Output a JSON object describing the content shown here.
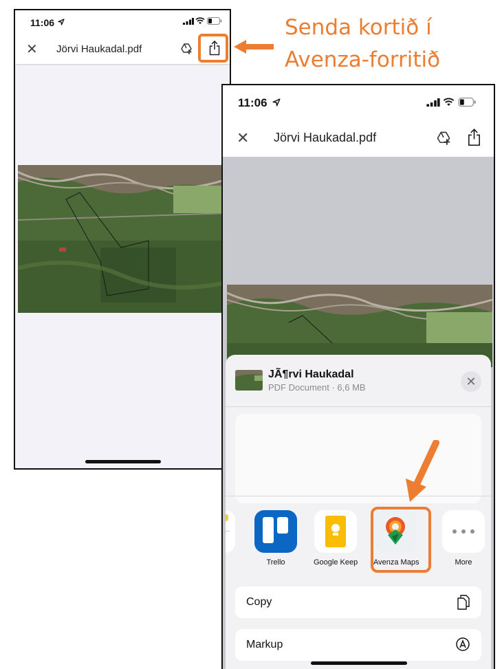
{
  "annotation": {
    "line1": "Senda kortið í",
    "line2": "Avenza-forritið",
    "color": "#ed7d31"
  },
  "phone1": {
    "time": "11:06",
    "doc_title": "Jörvi Haukadal.pdf"
  },
  "phone2": {
    "time": "11:06",
    "doc_title": "Jörvi Haukadal.pdf",
    "share_sheet": {
      "file_name": "JÃ¶rvi Haukadal",
      "file_meta": "PDF Document · 6,6 MB",
      "apps": [
        {
          "label": "Trello",
          "icon": "trello-icon"
        },
        {
          "label": "Google Keep",
          "icon": "google-keep-icon"
        },
        {
          "label": "Avenza Maps",
          "icon": "avenza-maps-icon"
        },
        {
          "label": "More",
          "icon": "more-icon"
        }
      ],
      "actions": [
        {
          "label": "Copy",
          "icon": "copy-icon"
        },
        {
          "label": "Markup",
          "icon": "markup-icon"
        }
      ]
    }
  },
  "colors": {
    "highlight": "#ed7d31",
    "trello": "#0c66c4",
    "keep": "#fbbc04"
  }
}
